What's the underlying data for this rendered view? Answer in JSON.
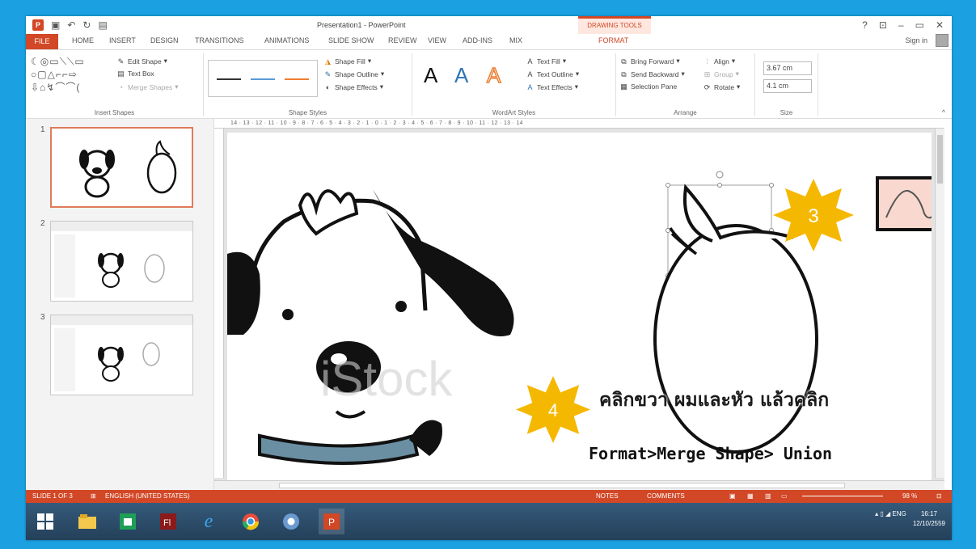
{
  "window": {
    "title": "Presentation1 - PowerPoint",
    "contextual_tab": "DRAWING TOOLS",
    "help": "?",
    "min": "–",
    "max": "▭",
    "close": "✕"
  },
  "tabs": [
    "FILE",
    "HOME",
    "INSERT",
    "DESIGN",
    "TRANSITIONS",
    "ANIMATIONS",
    "SLIDE SHOW",
    "REVIEW",
    "VIEW",
    "ADD-INS",
    "MIX",
    "FORMAT"
  ],
  "sign_in": "Sign in",
  "ribbon": {
    "insert_shapes": {
      "label": "Insert Shapes",
      "edit_shape": "Edit Shape",
      "text_box": "Text Box",
      "merge_shapes": "Merge Shapes"
    },
    "shape_styles": {
      "label": "Shape Styles",
      "fill": "Shape Fill",
      "outline": "Shape Outline",
      "effects": "Shape Effects"
    },
    "wordart_styles": {
      "label": "WordArt Styles",
      "text_fill": "Text Fill",
      "text_outline": "Text Outline",
      "text_effects": "Text Effects",
      "sample": "A"
    },
    "arrange": {
      "label": "Arrange",
      "bring_forward": "Bring Forward",
      "send_backward": "Send Backward",
      "selection_pane": "Selection Pane",
      "align": "Align",
      "group": "Group",
      "rotate": "Rotate"
    },
    "size": {
      "label": "Size",
      "height": "3.67 cm",
      "width": "4.1 cm"
    }
  },
  "ruler_text": "14 · 13 · 12 · 11 · 10 · 9 · 8 · 7 · 6 · 5 · 4 · 3 · 2 · 1 · 0 · 1 · 2 · 3 · 4 · 5 · 6 · 7 · 8 · 9 · 10 · 11 · 12 · 13 · 14",
  "thumbnails": [
    {
      "num": "1"
    },
    {
      "num": "2"
    },
    {
      "num": "3"
    }
  ],
  "slide": {
    "watermark": "iStock",
    "step3": "3",
    "step4": "4",
    "instruction_thai": "คลิกขวา ผมและหัว แล้วคลิก",
    "instruction_path": "Format>Merge Shape> Union"
  },
  "status": {
    "slide": "SLIDE 1 OF 3",
    "language": "ENGLISH (UNITED STATES)",
    "notes": "NOTES",
    "comments": "COMMENTS",
    "zoom": "98 %"
  },
  "tray": {
    "lang": "ENG",
    "time": "16:17",
    "date": "12/10/2559"
  },
  "colors": {
    "accent": "#d24726",
    "desktop": "#1ba1e2",
    "star": "#f5b800"
  }
}
